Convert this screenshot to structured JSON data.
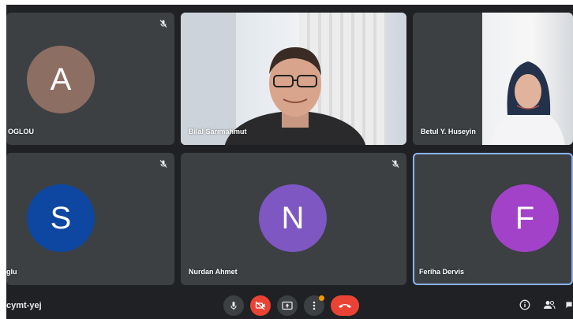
{
  "meeting": {
    "code": "cymt-yej"
  },
  "participants": [
    {
      "name": "OGLOU",
      "initial": "A",
      "color": "#8d6e63",
      "muted": true
    },
    {
      "name": "Bilal Sarımahmut",
      "video": true,
      "muted": false
    },
    {
      "name": "Betul Y. Huseyin",
      "video": true,
      "muted": false
    },
    {
      "name": "glu",
      "initial": "S",
      "color": "#0d47a1",
      "muted": true
    },
    {
      "name": "Nurdan Ahmet",
      "initial": "N",
      "color": "#7e57c2",
      "muted": true
    },
    {
      "name": "Feriha Dervis",
      "initial": "F",
      "color": "#a142c9",
      "muted": false,
      "active": true
    }
  ],
  "controls": [
    {
      "icon": "mic-icon"
    },
    {
      "icon": "camera-off-icon"
    },
    {
      "icon": "present-screen-icon"
    },
    {
      "icon": "more-options-icon"
    },
    {
      "icon": "end-call-icon"
    }
  ],
  "right_controls": [
    {
      "icon": "info-icon"
    },
    {
      "icon": "people-icon"
    },
    {
      "icon": "chat-icon"
    }
  ],
  "colors": {
    "background": "#202124",
    "tile": "#3c4043",
    "accent": "#8ab4f8",
    "danger": "#ea4335"
  }
}
